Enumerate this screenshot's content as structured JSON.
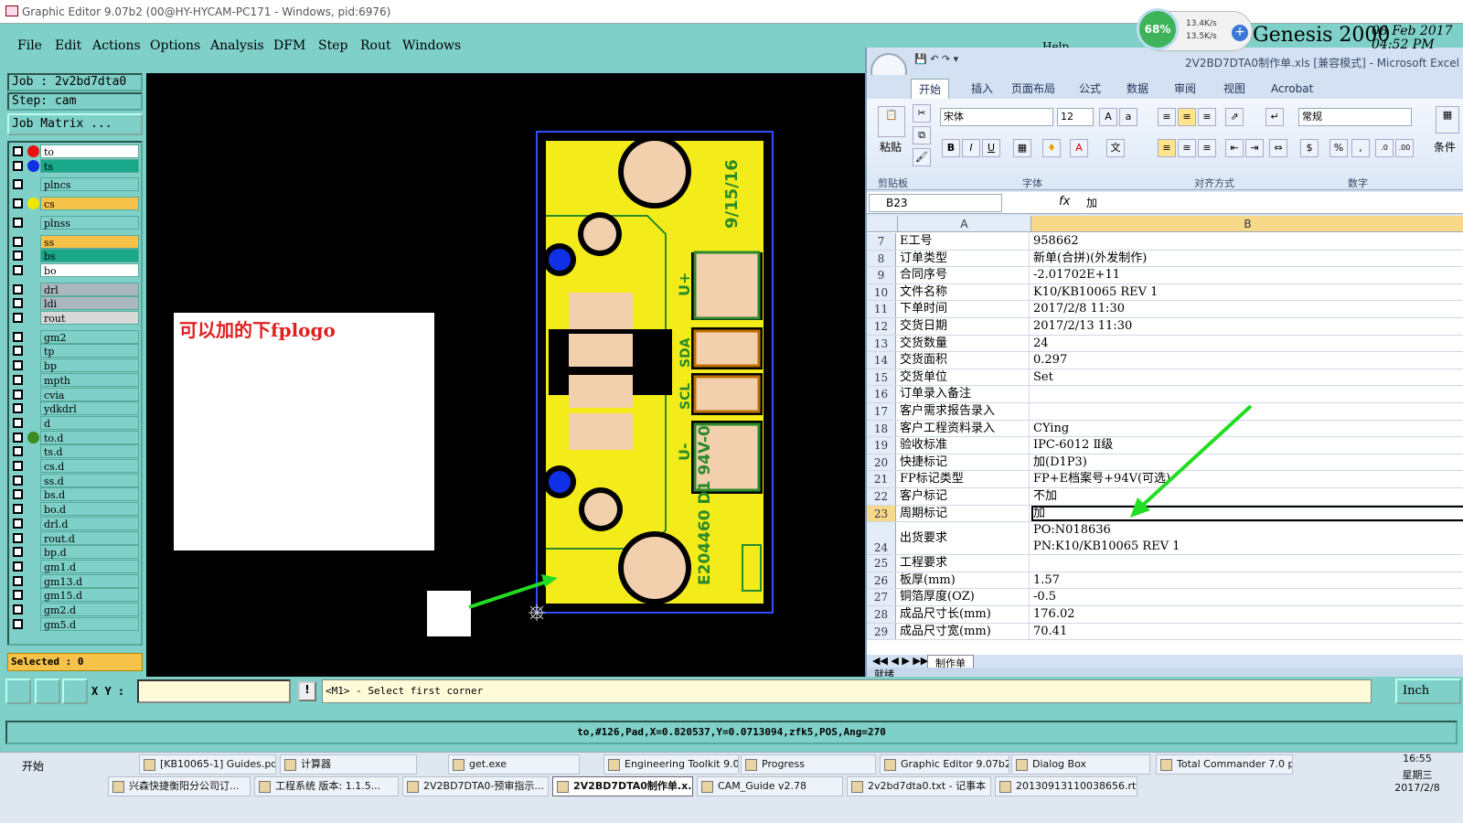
{
  "genesis": {
    "title": "Graphic Editor 9.07b2 (00@HY-HYCAM-PC171 - Windows, pid:6976)",
    "menus": [
      "File",
      "Edit",
      "Actions",
      "Options",
      "Analysis",
      "DFM",
      "Step",
      "Rout",
      "Windows"
    ],
    "help": "Help",
    "job_label": "Job : 2v2bd7dta0",
    "step_label": "Step: cam",
    "job_matrix": "Job Matrix ...",
    "layers": [
      {
        "name": "to",
        "dot": "#e81010",
        "bg": "#ffffff"
      },
      {
        "name": "ts",
        "dot": "#1030e8",
        "bg": "#1aa88a"
      },
      {
        "name": "plncs",
        "dot": "",
        "bg": "#7fd0c8"
      },
      {
        "name": "cs",
        "dot": "#f2e600",
        "bg": "#f7c24a"
      },
      {
        "name": "plnss",
        "dot": "",
        "bg": "#7fd0c8"
      },
      {
        "name": "ss",
        "dot": "",
        "bg": "#f7c24a"
      },
      {
        "name": "bs",
        "dot": "",
        "bg": "#1aa88a"
      },
      {
        "name": "bo",
        "dot": "",
        "bg": "#ffffff"
      },
      {
        "name": "drl",
        "dot": "",
        "bg": "#aab8be"
      },
      {
        "name": "ldi",
        "dot": "",
        "bg": "#aab8be"
      },
      {
        "name": "rout",
        "dot": "",
        "bg": "#d8d8d8"
      },
      {
        "name": "gm2",
        "dot": "",
        "bg": "#7fd0c8"
      },
      {
        "name": "tp",
        "dot": "",
        "bg": "#7fd0c8"
      },
      {
        "name": "bp",
        "dot": "",
        "bg": "#7fd0c8"
      },
      {
        "name": "mpth",
        "dot": "",
        "bg": "#7fd0c8"
      },
      {
        "name": "cvia",
        "dot": "",
        "bg": "#7fd0c8"
      },
      {
        "name": "ydkdrl",
        "dot": "",
        "bg": "#7fd0c8"
      },
      {
        "name": "d",
        "dot": "",
        "bg": "#7fd0c8"
      },
      {
        "name": "to.d",
        "dot": "#3c8c20",
        "bg": "#7fd0c8"
      },
      {
        "name": "ts.d",
        "dot": "",
        "bg": "#7fd0c8"
      },
      {
        "name": "cs.d",
        "dot": "",
        "bg": "#7fd0c8"
      },
      {
        "name": "ss.d",
        "dot": "",
        "bg": "#7fd0c8"
      },
      {
        "name": "bs.d",
        "dot": "",
        "bg": "#7fd0c8"
      },
      {
        "name": "bo.d",
        "dot": "",
        "bg": "#7fd0c8"
      },
      {
        "name": "drl.d",
        "dot": "",
        "bg": "#7fd0c8"
      },
      {
        "name": "rout.d",
        "dot": "",
        "bg": "#7fd0c8"
      },
      {
        "name": "bp.d",
        "dot": "",
        "bg": "#7fd0c8"
      },
      {
        "name": "gm1.d",
        "dot": "",
        "bg": "#7fd0c8"
      },
      {
        "name": "gm13.d",
        "dot": "",
        "bg": "#7fd0c8"
      },
      {
        "name": "gm15.d",
        "dot": "",
        "bg": "#7fd0c8"
      },
      {
        "name": "gm2.d",
        "dot": "",
        "bg": "#7fd0c8"
      },
      {
        "name": "gm5.d",
        "dot": "",
        "bg": "#7fd0c8"
      }
    ],
    "selected": "Selected : 0",
    "canvas_note": "可以加的下fplogo",
    "board_text": {
      "date": "9/15/16",
      "vplus": "U+",
      "sda": "SDA",
      "scl": "SCL",
      "vminus": "U-",
      "ul": "E204460 D1 94V-0"
    },
    "xy_label": "X Y :",
    "prompt": "<M1> - Select first corner",
    "unit": "Inch",
    "status": "to,#126,Pad,X=0.820537,Y=0.0713094,zfk5,POS,Ang=270",
    "brand": "Genesis 2000",
    "date_line1": "08 Feb 2017",
    "date_line2": "04:52 PM"
  },
  "net_widget": {
    "percent": "68%",
    "up": "13.4K/s",
    "down": "13.5K/s",
    "plus": "+"
  },
  "excel": {
    "doc_title": "2V2BD7DTA0制作单.xls  [兼容模式] - Microsoft Excel",
    "tabs": [
      "开始",
      "插入",
      "页面布局",
      "公式",
      "数据",
      "审阅",
      "视图",
      "Acrobat"
    ],
    "font_name": "宋体",
    "font_size": "12",
    "number_format": "常规",
    "group_labels": [
      "剪贴板",
      "字体",
      "对齐方式",
      "数字"
    ],
    "paste_label": "粘贴",
    "style_label": "条件",
    "name_box": "B23",
    "fx": "fx",
    "formula_value": "加",
    "col_a": "A",
    "col_b": "B",
    "rows": [
      {
        "n": "7",
        "a": "E工号",
        "b": "958662"
      },
      {
        "n": "8",
        "a": "订单类型",
        "b": "新单(合拼)(外发制作)"
      },
      {
        "n": "9",
        "a": "合同序号",
        "b": "-2.01702E+11"
      },
      {
        "n": "10",
        "a": "文件名称",
        "b": "K10/KB10065 REV 1"
      },
      {
        "n": "11",
        "a": "下单时间",
        "b": "2017/2/8 11:30"
      },
      {
        "n": "12",
        "a": "交货日期",
        "b": "2017/2/13 11:30"
      },
      {
        "n": "13",
        "a": "交货数量",
        "b": "24"
      },
      {
        "n": "14",
        "a": "交货面积",
        "b": "0.297"
      },
      {
        "n": "15",
        "a": "交货单位",
        "b": "Set"
      },
      {
        "n": "16",
        "a": "订单录入备注",
        "b": ""
      },
      {
        "n": "17",
        "a": "客户需求报告录入",
        "b": ""
      },
      {
        "n": "18",
        "a": "客户工程资料录入",
        "b": "CYing"
      },
      {
        "n": "19",
        "a": "验收标准",
        "b": "IPC-6012 Ⅱ级"
      },
      {
        "n": "20",
        "a": "快捷标记",
        "b": "加(D1P3)"
      },
      {
        "n": "21",
        "a": "FP标记类型",
        "b": "FP+E档案号+94V(可选)"
      },
      {
        "n": "22",
        "a": "客户标记",
        "b": "不加"
      },
      {
        "n": "23",
        "a": "周期标记",
        "b": "加"
      },
      {
        "n": "24",
        "a": "出货要求",
        "b": "PO:N018636",
        "b2": "PN:K10/KB10065 REV 1"
      },
      {
        "n": "25",
        "a": "工程要求",
        "b": ""
      },
      {
        "n": "26",
        "a": "板厚(mm)",
        "b": "1.57"
      },
      {
        "n": "27",
        "a": "铜箔厚度(OZ)",
        "b": "-0.5"
      },
      {
        "n": "28",
        "a": "成品尺寸长(mm)",
        "b": "176.02"
      },
      {
        "n": "29",
        "a": "成品尺寸宽(mm)",
        "b": "70.41"
      }
    ],
    "sheet_tab": "制作单",
    "status": "就绪"
  },
  "taskbar": {
    "start": "开始",
    "row1": [
      "[KB10065-1] Guides.pd...",
      "计算器",
      "get.exe",
      "Engineering Toolkit 9.0...",
      "Progress",
      "Graphic Editor 9.07b2 (...",
      "Dialog Box",
      "Total Commander 7.0 p..."
    ],
    "row2": [
      "兴森快捷衡阳分公司订...",
      "工程系统  版本: 1.1.5...",
      "2V2BD7DTA0-预审指示...",
      "2V2BD7DTA0制作单.x...",
      "CAM_Guide v2.78",
      "2v2bd7dta0.txt - 记事本",
      "20130913110038656.rtf..."
    ],
    "clock_time": "16:55",
    "clock_day": "星期三",
    "clock_date": "2017/2/8"
  }
}
